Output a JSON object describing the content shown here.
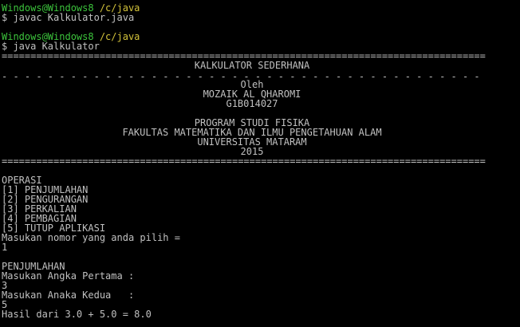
{
  "colors": {
    "background": "#000000",
    "text": "#c0c0c0",
    "prompt_user": "#3cc43c",
    "prompt_path": "#d2c23a"
  },
  "prompt1": {
    "user": "Windows@Windows8",
    "path": " /c/java",
    "command": "$ javac Kalkulator.java"
  },
  "prompt2": {
    "user": "Windows@Windows8",
    "path": " /c/java",
    "command": "$ java Kalkulator"
  },
  "rules": {
    "double": "====================================================================================",
    "dashed": "- - - - - - - - - - - - - - - - - - - - - - - - - - - - - - - - - - - - - - - - - -"
  },
  "header": {
    "title": "KALKULATOR SEDERHANA",
    "by": "Oleh",
    "author": "MOZAIK AL QHAROMI",
    "nim": "G1B014027",
    "program": "PROGRAM STUDI FISIKA",
    "faculty": "FAKULTAS MATEMATIKA DAN ILMU PENGETAHUAN ALAM",
    "university": "UNIVERSITAS MATARAM",
    "year": "2015"
  },
  "menu": {
    "title": "OPERASI",
    "items": [
      "[1] PENJUMLAHAN",
      "[2] PENGURANGAN",
      "[3] PERKALIAN",
      "[4] PEMBAGIAN",
      "[5] TUTUP APLIKASI"
    ],
    "prompt": "Masukan nomor yang anda pilih =",
    "input": "1"
  },
  "operation": {
    "name": "PENJUMLAHAN",
    "first_prompt": "Masukan Angka Pertama :",
    "first_value": "3",
    "second_prompt": "Masukan Anaka Kedua   :",
    "second_value": "5",
    "result": "Hasil dari 3.0 + 5.0 = 8.0"
  }
}
